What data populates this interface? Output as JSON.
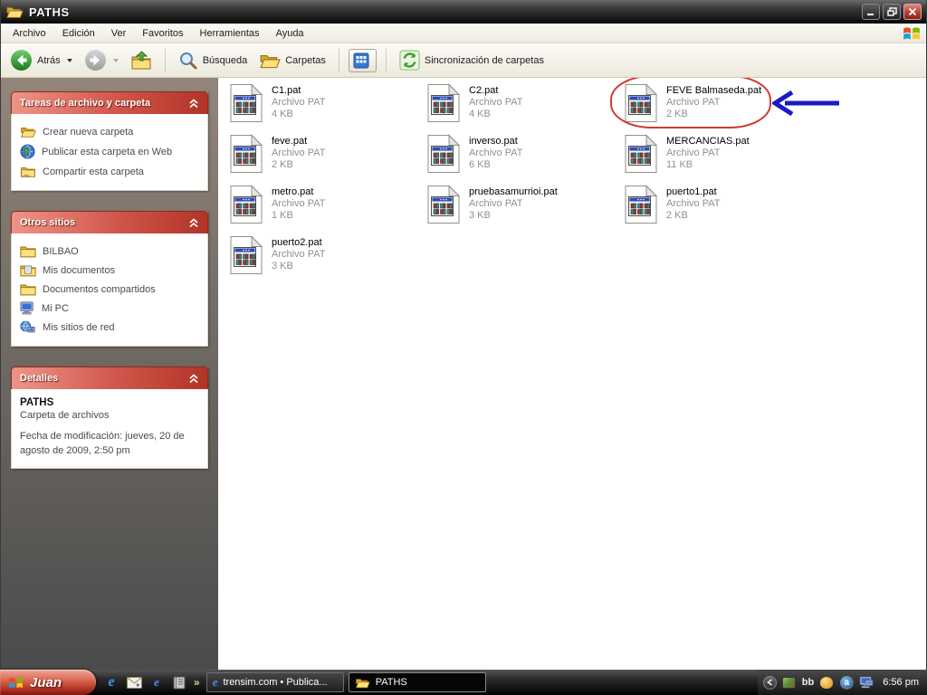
{
  "window": {
    "title": "PATHS"
  },
  "menu": {
    "items": [
      "Archivo",
      "Edición",
      "Ver",
      "Favoritos",
      "Herramientas",
      "Ayuda"
    ]
  },
  "toolbar": {
    "back_label": "Atrás",
    "search_label": "Búsqueda",
    "folders_label": "Carpetas",
    "sync_label": "Sincronización de carpetas"
  },
  "sidebar": {
    "tasks": {
      "title": "Tareas de archivo y carpeta",
      "items": [
        "Crear nueva carpeta",
        "Publicar esta carpeta en Web",
        "Compartir esta carpeta"
      ]
    },
    "places": {
      "title": "Otros sitios",
      "items": [
        "BILBAO",
        "Mis documentos",
        "Documentos compartidos",
        "Mi PC",
        "Mis sitios de red"
      ]
    },
    "details": {
      "title": "Detalles",
      "name": "PATHS",
      "type": "Carpeta de archivos",
      "modified": "Fecha de modificación: jueves, 20 de agosto de 2009, 2:50 pm"
    }
  },
  "files": [
    {
      "name": "C1.pat",
      "type": "Archivo PAT",
      "size": "4 KB"
    },
    {
      "name": "C2.pat",
      "type": "Archivo PAT",
      "size": "4 KB"
    },
    {
      "name": "FEVE Balmaseda.pat",
      "type": "Archivo PAT",
      "size": "2 KB",
      "highlighted": true
    },
    {
      "name": "feve.pat",
      "type": "Archivo PAT",
      "size": "2 KB"
    },
    {
      "name": "inverso.pat",
      "type": "Archivo PAT",
      "size": "6 KB"
    },
    {
      "name": "MERCANCIAS.pat",
      "type": "Archivo PAT",
      "size": "11 KB"
    },
    {
      "name": "metro.pat",
      "type": "Archivo PAT",
      "size": "1 KB"
    },
    {
      "name": "pruebasamurrioi.pat",
      "type": "Archivo PAT",
      "size": "3 KB"
    },
    {
      "name": "puerto1.pat",
      "type": "Archivo PAT",
      "size": "2 KB"
    },
    {
      "name": "puerto2.pat",
      "type": "Archivo PAT",
      "size": "3 KB"
    }
  ],
  "annotations": {
    "ellipse_color": "#cf3a30",
    "arrow_color": "#1a1ac4",
    "target_file": "FEVE Balmaseda.pat"
  },
  "taskbar": {
    "start_label": "Juan",
    "quicklaunch": {
      "more_label": "»",
      "icon_names": [
        "internet-explorer",
        "outlook-express",
        "internet-document",
        "notebook"
      ]
    },
    "tasks": [
      {
        "label": "trensim.com • Publica...",
        "active": false
      },
      {
        "label": "PATHS",
        "active": true
      }
    ],
    "tray": {
      "bb_label": "bb",
      "time": "6:56 pm"
    }
  },
  "icons": {
    "ie_glyph": "e",
    "avast_glyph": "a"
  },
  "colors": {
    "section_header_red": "#c0392b",
    "sidebar_top": "#93857a",
    "sidebar_bottom": "#4b4b4b",
    "start_button_red": "#c94a38"
  }
}
